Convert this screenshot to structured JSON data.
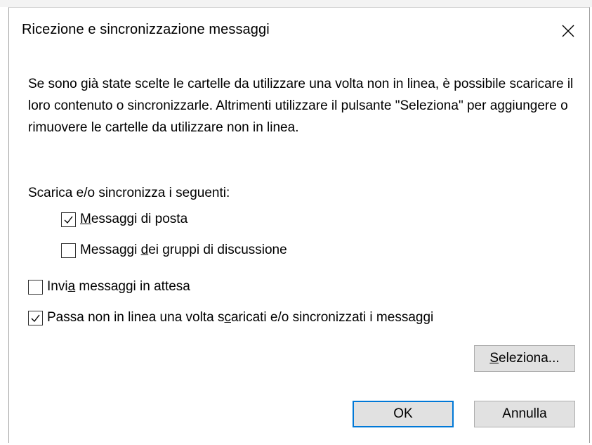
{
  "dialog": {
    "title": "Ricezione e sincronizzazione messaggi",
    "description": "Se sono già state scelte le cartelle da utilizzare una volta non in linea, è possibile scaricare il loro contenuto o sincronizzarle. Altrimenti utilizzare il pulsante \"Seleziona\" per aggiungere o rimuovere le cartelle da utilizzare non in linea.",
    "section_label": "Scarica e/o sincronizza i seguenti:"
  },
  "options": {
    "mail": {
      "pre": "",
      "key": "M",
      "post": "essaggi di posta",
      "checked": true
    },
    "news": {
      "pre": "Messaggi ",
      "key": "d",
      "post": "ei gruppi di discussione",
      "checked": false
    },
    "send": {
      "pre": "Invi",
      "key": "a",
      "post": " messaggi in attesa",
      "checked": false
    },
    "offline": {
      "pre": "Passa non in linea una volta s",
      "key": "c",
      "post": "aricati e/o sincronizzati i messaggi",
      "checked": true
    }
  },
  "buttons": {
    "select": {
      "key": "S",
      "post": "eleziona..."
    },
    "ok": "OK",
    "cancel": "Annulla"
  },
  "icons": {
    "close": "close-icon",
    "check": "checkmark-icon"
  },
  "colors": {
    "default_button_border": "#0078d7",
    "button_face": "#e1e1e1"
  }
}
